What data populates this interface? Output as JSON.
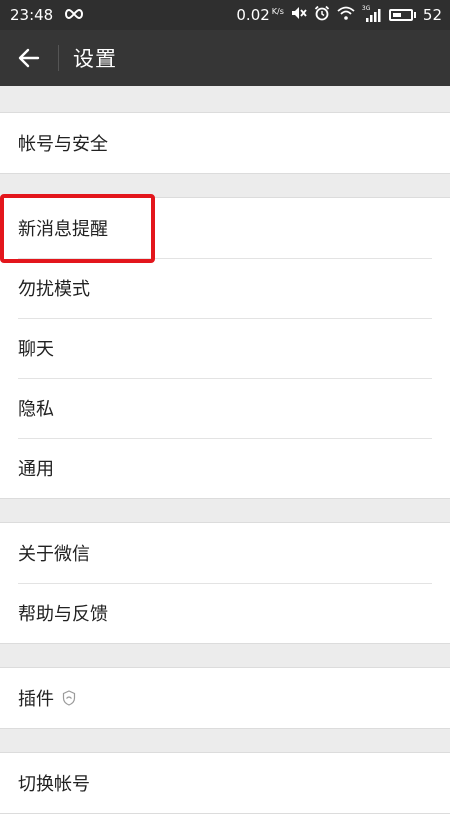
{
  "status_bar": {
    "time": "23:48",
    "net_speed_value": "0.02",
    "net_speed_unit": "K/s",
    "signal_label": "3G",
    "battery_level": "52",
    "battery_fraction": 0.52
  },
  "header": {
    "title": "设置"
  },
  "settings": {
    "groups": [
      {
        "items": [
          "帐号与安全"
        ]
      },
      {
        "items": [
          "新消息提醒",
          "勿扰模式",
          "聊天",
          "隐私",
          "通用"
        ]
      },
      {
        "items": [
          "关于微信",
          "帮助与反馈"
        ]
      },
      {
        "items": [
          "插件"
        ]
      },
      {
        "items": [
          "切换帐号"
        ]
      }
    ]
  },
  "colors": {
    "status_bar_bg": "#2f2f2f",
    "title_bar_bg": "#363636",
    "page_bg": "#ececec",
    "highlight": "#e3161c"
  }
}
